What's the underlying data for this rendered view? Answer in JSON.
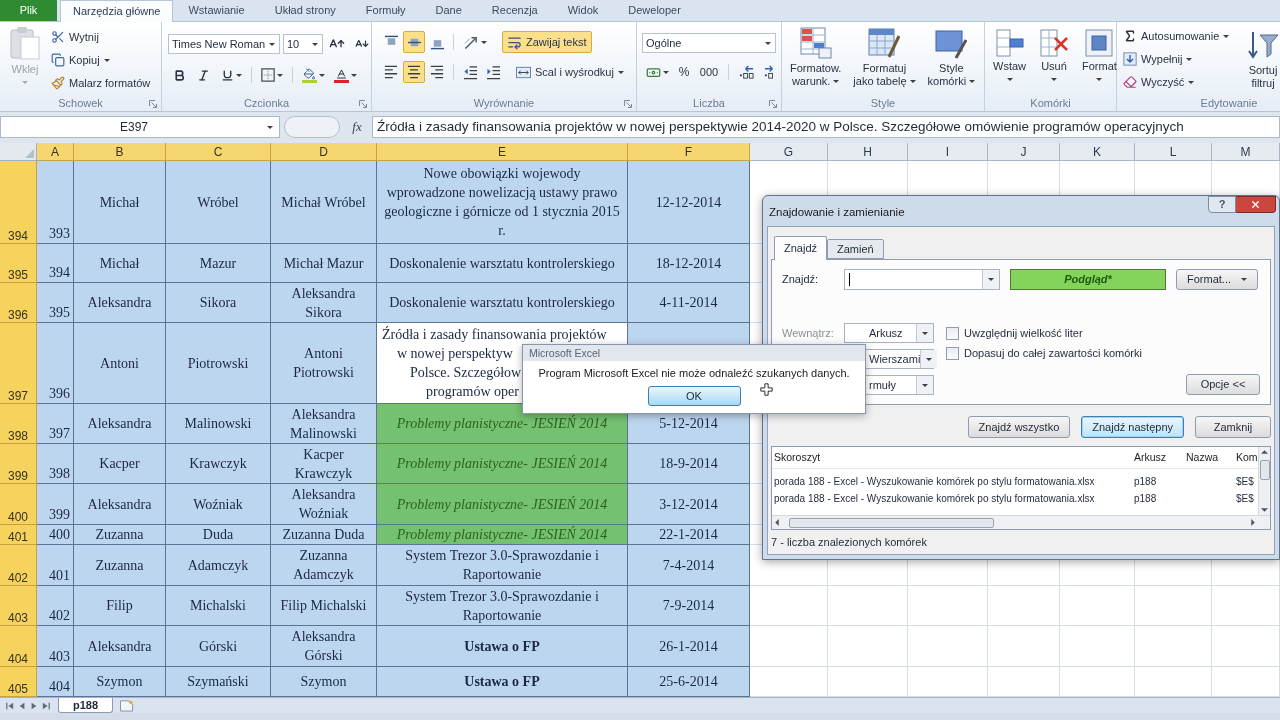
{
  "ribbon_tabs": [
    {
      "label": "Plik",
      "kind": "file",
      "selected": false
    },
    {
      "label": "Narzędzia główne",
      "kind": "tab",
      "selected": true
    },
    {
      "label": "Wstawianie",
      "kind": "tab",
      "selected": false
    },
    {
      "label": "Układ strony",
      "kind": "tab",
      "selected": false
    },
    {
      "label": "Formuły",
      "kind": "tab",
      "selected": false
    },
    {
      "label": "Dane",
      "kind": "tab",
      "selected": false
    },
    {
      "label": "Recenzja",
      "kind": "tab",
      "selected": false
    },
    {
      "label": "Widok",
      "kind": "tab",
      "selected": false
    },
    {
      "label": "Deweloper",
      "kind": "tab",
      "selected": false
    }
  ],
  "ribbon": {
    "clipboard": {
      "label": "Schowek",
      "paste": {
        "label": "Wklej",
        "disabled": true
      },
      "commands": [
        {
          "label": "Wytnij",
          "dropdown": false
        },
        {
          "label": "Kopiuj",
          "dropdown": true
        },
        {
          "label": "Malarz formatów",
          "dropdown": false
        }
      ]
    },
    "font": {
      "label": "Czcionka",
      "font_name": "Times New Roman",
      "font_size": "10"
    },
    "alignment": {
      "label": "Wyrównanie",
      "vertical": [
        {
          "selected": false
        },
        {
          "selected": true
        },
        {
          "selected": false
        }
      ],
      "horizontal": [
        {
          "selected": false
        },
        {
          "selected": true
        },
        {
          "selected": false
        }
      ],
      "wrap_text": {
        "label": "Zawijaj tekst",
        "selected": true
      },
      "merge": {
        "label": "Scal i wyśrodkuj"
      }
    },
    "number": {
      "label": "Liczba",
      "format": "Ogólne",
      "percent": "%",
      "thousands": "000"
    },
    "styles": {
      "label": "Style",
      "commands": [
        {
          "lines": [
            "Formatow.",
            "warunk."
          ]
        },
        {
          "lines": [
            "Formatuj",
            "jako tabelę"
          ]
        },
        {
          "lines": [
            "Style",
            "komórki"
          ]
        }
      ]
    },
    "cells": {
      "label": "Komórki",
      "commands": [
        {
          "lines": [
            "Wstaw"
          ]
        },
        {
          "lines": [
            "Usuń"
          ]
        },
        {
          "lines": [
            "Format"
          ]
        }
      ]
    },
    "editing": {
      "label": "Edytowanie",
      "commands": [
        {
          "label": "Autosumowanie"
        },
        {
          "label": "Wypełnij"
        },
        {
          "label": "Wyczyść"
        }
      ],
      "sort": {
        "lines": [
          "Sortuj",
          "filtruj"
        ]
      }
    }
  },
  "formula_bar": {
    "name_box": "E397",
    "function_label": "fx",
    "formula": "Źródła i zasady finansowania projektów w nowej perspektywie 2014-2020 w Polsce. Szczegółowe omówienie programów operacyjnych"
  },
  "sheet": {
    "columns": [
      {
        "label": "A",
        "selected": true
      },
      {
        "label": "B",
        "selected": true
      },
      {
        "label": "C",
        "selected": true
      },
      {
        "label": "D",
        "selected": true
      },
      {
        "label": "E",
        "selected": true
      },
      {
        "label": "F",
        "selected": true
      },
      {
        "label": "G",
        "selected": false
      },
      {
        "label": "H",
        "selected": false
      },
      {
        "label": "I",
        "selected": false
      },
      {
        "label": "J",
        "selected": false
      },
      {
        "label": "K",
        "selected": false
      },
      {
        "label": "L",
        "selected": false
      },
      {
        "label": "M",
        "selected": false
      }
    ],
    "rows": [
      {
        "header": "394",
        "selected": true,
        "cells": [
          "393",
          "Michał",
          "Wróbel",
          "Michał Wróbel",
          [
            "Nowe obowiązki wojewody",
            "wprowadzone nowelizacją ustawy prawo",
            "geologiczne i górnicze od 1 stycznia 2015",
            "r."
          ],
          "12-12-2014"
        ]
      },
      {
        "header": "395",
        "selected": true,
        "cells": [
          "394",
          "Michał",
          "Mazur",
          "Michał Mazur",
          "Doskonalenie warsztatu kontrolerskiego",
          "18-12-2014"
        ]
      },
      {
        "header": "396",
        "selected": true,
        "cells": [
          "395",
          "Aleksandra",
          "Sikora",
          [
            "Aleksandra",
            "Sikora"
          ],
          "Doskonalenie warsztatu kontrolerskiego",
          "4-11-2014"
        ]
      },
      {
        "header": "397",
        "selected": true,
        "cells": [
          "396",
          "Antoni",
          "Piotrowski",
          [
            "Antoni",
            "Piotrowski"
          ],
          {
            "lines": [
              "Źródła i zasady finansowania projektów",
              "w nowej perspektyw",
              "Polsce. Szczegółow",
              "programów oper"
            ],
            "kind": "active"
          }
        ]
      },
      {
        "header": "398",
        "selected": true,
        "cells": [
          "397",
          "Aleksandra",
          "Malinowski",
          [
            "Aleksandra",
            "Malinowski"
          ],
          {
            "lines": [
              "Problemy planistyczne- JESIEŃ 2014"
            ],
            "kind": "highlighted"
          },
          "5-12-2014"
        ]
      },
      {
        "header": "399",
        "selected": true,
        "cells": [
          "398",
          "Kacper",
          "Krawczyk",
          [
            "Kacper",
            "Krawczyk"
          ],
          {
            "lines": [
              "Problemy planistyczne- JESIEŃ 2014"
            ],
            "kind": "highlighted"
          },
          "18-9-2014"
        ]
      },
      {
        "header": "400",
        "selected": true,
        "cells": [
          "399",
          "Aleksandra",
          "Woźniak",
          [
            "Aleksandra",
            "Woźniak"
          ],
          {
            "lines": [
              "Problemy planistyczne- JESIEŃ 2014"
            ],
            "kind": "highlighted"
          },
          "3-12-2014"
        ]
      },
      {
        "header": "401",
        "selected": true,
        "cells": [
          "400",
          "Zuzanna",
          "Duda",
          "Zuzanna Duda",
          {
            "lines": [
              "Problemy planistyczne- JESIEŃ 2014"
            ],
            "kind": "highlighted"
          },
          "22-1-2014"
        ]
      },
      {
        "header": "402",
        "selected": true,
        "cells": [
          "401",
          "Zuzanna",
          "Adamczyk",
          [
            "Zuzanna",
            "Adamczyk"
          ],
          [
            "System Trezor 3.0-Sprawozdanie i",
            "Raportowanie"
          ],
          "7-4-2014"
        ]
      },
      {
        "header": "403",
        "selected": true,
        "cells": [
          "402",
          "Filip",
          "Michalski",
          "Filip Michalski",
          [
            "System Trezor 3.0-Sprawozdanie i",
            "Raportowanie"
          ],
          "7-9-2014"
        ]
      },
      {
        "header": "404",
        "selected": true,
        "cells": [
          "403",
          "Aleksandra",
          "Górski",
          [
            "Aleksandra",
            "Górski"
          ],
          {
            "lines": [
              "Ustawa o FP"
            ],
            "kind": "bold"
          },
          "26-1-2014"
        ]
      },
      {
        "header": "405",
        "selected": true,
        "cells": [
          "404",
          "Szymon",
          "Szymański",
          [
            "Szymon"
          ],
          {
            "lines": [
              "Ustawa o FP"
            ],
            "kind": "bold"
          },
          "25-6-2014"
        ]
      }
    ]
  },
  "sheet_tabs": [
    {
      "label": "p188",
      "selected": true
    }
  ],
  "find_dialog": {
    "title": "Znajdowanie i zamienianie",
    "help_button": "?",
    "tabs": [
      {
        "label": "Znajdź",
        "selected": true
      },
      {
        "label": "Zamień",
        "selected": false
      }
    ],
    "find_label": "Znajdź:",
    "preview": "Podgląd*",
    "format_button": "Format...",
    "scope_label": "Wewnątrz:",
    "selects": [
      "Arkusz",
      "Wierszami",
      "rmuły"
    ],
    "checkboxes": [
      {
        "label": "Uwzględnij wielkość liter",
        "checked": false
      },
      {
        "label": "Dopasuj do całej zawartości komórki",
        "checked": false
      }
    ],
    "options_button": "Opcje <<",
    "buttons": [
      {
        "label": "Znajdź wszystko",
        "default": false
      },
      {
        "label": "Znajdź następny",
        "default": true
      },
      {
        "label": "Zamknij",
        "default": false
      }
    ],
    "results": {
      "columns": [
        "Skoroszyt",
        "Arkusz",
        "Nazwa",
        "Kom"
      ],
      "rows": [
        {
          "workbook": "porada 188 - Excel - Wyszukowanie komórek po stylu formatowania.xlsx",
          "sheet": "p188",
          "cell": "$E$"
        },
        {
          "workbook": "porada 188 - Excel - Wyszukowanie komórek po stylu formatowania.xlsx",
          "sheet": "p188",
          "cell": "$E$"
        }
      ]
    },
    "status": "7 - liczba znalezionych komórek"
  },
  "message_box": {
    "title": "Microsoft Excel",
    "message": "Program Microsoft Excel nie może odnaleźć szukanych danych.",
    "button": "OK"
  }
}
